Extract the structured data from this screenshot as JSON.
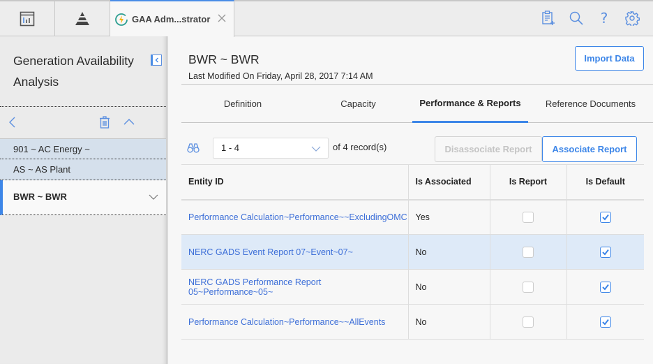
{
  "topbar": {
    "nav_buttons": [
      {
        "icon": "dashboard-icon"
      },
      {
        "icon": "pyramid-icon"
      }
    ],
    "active_tab": {
      "label": "GAA Adm...strator",
      "icon": "gaa-lightning-icon",
      "close_icon": "close-icon"
    },
    "actions": [
      {
        "icon": "clipboard-add-icon"
      },
      {
        "icon": "search-icon"
      },
      {
        "icon": "help-icon",
        "glyph": "?"
      },
      {
        "icon": "gear-icon"
      }
    ]
  },
  "sidebar": {
    "title": "Generation Availability Analysis",
    "tools": {
      "back": "chevron-left-icon",
      "delete": "trash-icon",
      "collapse": "chevron-up-icon"
    },
    "items": [
      {
        "label": "901 ~ AC Energy ~",
        "active": false
      },
      {
        "label": "AS ~ AS Plant",
        "active": false
      },
      {
        "label": "BWR ~ BWR",
        "active": true
      }
    ]
  },
  "main": {
    "title": "BWR ~ BWR",
    "subtitle": "Last Modified On Friday, April 28, 2017 7:14 AM",
    "import_button": "Import Data",
    "tabs": [
      {
        "label": "Definition",
        "active": false
      },
      {
        "label": "Capacity",
        "active": false
      },
      {
        "label": "Performance & Reports",
        "active": true
      },
      {
        "label": "Reference Documents",
        "active": false
      }
    ],
    "toolbar": {
      "page_range": "1 - 4",
      "records_text": "of 4 record(s)",
      "disassociate_label": "Disassociate Report",
      "associate_label": "Associate Report"
    },
    "grid": {
      "columns": [
        "Entity ID",
        "Is Associated",
        "Is Report",
        "Is Default"
      ],
      "rows": [
        {
          "entity_id": "Performance Calculation~Performance~~ExcludingOMC",
          "is_associated": "Yes",
          "is_report": false,
          "is_default": true,
          "highlighted": false
        },
        {
          "entity_id": "NERC GADS Event Report 07~Event~07~",
          "is_associated": "No",
          "is_report": false,
          "is_default": true,
          "highlighted": true
        },
        {
          "entity_id": "NERC GADS Performance Report 05~Performance~05~",
          "is_associated": "No",
          "is_report": false,
          "is_default": true,
          "highlighted": false
        },
        {
          "entity_id": "Performance Calculation~Performance~~AllEvents",
          "is_associated": "No",
          "is_report": false,
          "is_default": true,
          "highlighted": false
        }
      ]
    }
  },
  "colors": {
    "accent": "#3d86e8",
    "link": "#3d6fd8",
    "row_highlight": "#deeaf8",
    "sidebar_item_bg": "#d5e0ec"
  }
}
